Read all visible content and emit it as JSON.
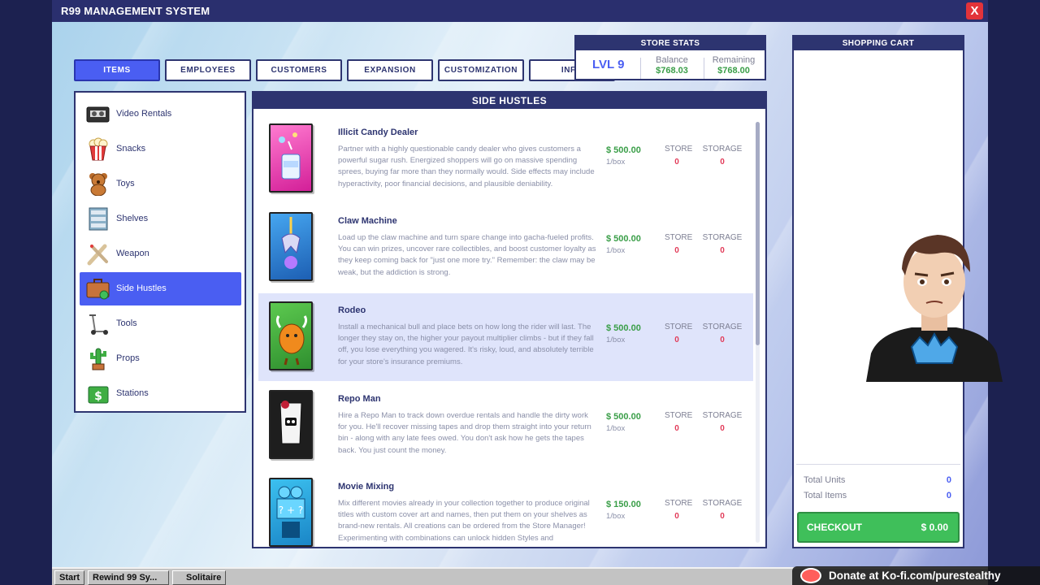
{
  "window": {
    "title": "R99 MANAGEMENT SYSTEM",
    "close_label": "X"
  },
  "tabs": [
    {
      "label": "ITEMS",
      "active": true
    },
    {
      "label": "EMPLOYEES"
    },
    {
      "label": "CUSTOMERS"
    },
    {
      "label": "EXPANSION"
    },
    {
      "label": "CUSTOMIZATION"
    },
    {
      "label": "INFO"
    }
  ],
  "stats": {
    "title": "STORE STATS",
    "level": "LVL 9",
    "balance_label": "Balance",
    "balance": "$768.03",
    "remaining_label": "Remaining",
    "remaining": "$768.00"
  },
  "categories": [
    {
      "label": "Video Rentals",
      "icon": "vhs-tape-icon"
    },
    {
      "label": "Snacks",
      "icon": "popcorn-icon"
    },
    {
      "label": "Toys",
      "icon": "teddy-bear-icon"
    },
    {
      "label": "Shelves",
      "icon": "shelf-icon"
    },
    {
      "label": "Weapon",
      "icon": "bat-icon"
    },
    {
      "label": "Side Hustles",
      "icon": "briefcase-icon",
      "active": true
    },
    {
      "label": "Tools",
      "icon": "scooter-icon"
    },
    {
      "label": "Props",
      "icon": "cactus-icon"
    },
    {
      "label": "Stations",
      "icon": "cash-icon"
    }
  ],
  "panel": {
    "title": "SIDE HUSTLES",
    "store_label": "STORE",
    "storage_label": "STORAGE",
    "items": [
      {
        "name": "Illicit Candy Dealer",
        "desc": "Partner with a highly questionable candy dealer who gives customers a powerful sugar rush. Energized shoppers will go on massive spending sprees, buying far more than they normally would. Side effects may include hyperactivity, poor financial decisions, and plausible deniability.",
        "price": "$ 500.00",
        "unit": "1/box",
        "store": "0",
        "storage": "0",
        "card_color": "#ea4fb0"
      },
      {
        "name": "Claw Machine",
        "desc": "Load up the claw machine and turn spare change into gacha-fueled profits. You can win prizes, uncover rare collectibles, and boost customer loyalty as they keep coming back for \"just one more try.\" Remember: the claw may be weak, but the addiction is strong.",
        "price": "$ 500.00",
        "unit": "1/box",
        "store": "0",
        "storage": "0",
        "card_color": "#2c83d6"
      },
      {
        "name": "Rodeo",
        "desc": "Install a mechanical bull and place bets on how long the rider will last. The longer they stay on, the higher your payout multiplier climbs - but if they fall off, you lose everything you wagered. It's risky, loud, and absolutely terrible for your store's insurance premiums.",
        "price": "$ 500.00",
        "unit": "1/box",
        "store": "0",
        "storage": "0",
        "card_color": "#3fae43",
        "selected": true
      },
      {
        "name": "Repo Man",
        "desc": "Hire a Repo Man to track down overdue rentals and handle the dirty work for you. He'll recover missing tapes and drop them straight into your return bin - along with any late fees owed. You don't ask how he gets the tapes back. You just count the money.",
        "price": "$ 500.00",
        "unit": "1/box",
        "store": "0",
        "storage": "0",
        "card_color": "#222222"
      },
      {
        "name": "Movie Mixing",
        "desc": "Mix different movies already in your collection together to produce original titles with custom cover art and names, then put them on your shelves as brand-new rentals. All creations can be ordered from the Store Manager! Experimenting with combinations can unlock hidden Styles and",
        "price": "$ 150.00",
        "unit": "1/box",
        "store": "0",
        "storage": "0",
        "card_color": "#2aa7e0"
      }
    ]
  },
  "cart": {
    "title": "SHOPPING CART",
    "total_units_label": "Total Units",
    "total_units": "0",
    "total_items_label": "Total Items",
    "total_items": "0",
    "checkout_label": "CHECKOUT",
    "checkout_amount": "$ 0.00"
  },
  "taskbar": {
    "start_label": "Start",
    "window_label": "Rewind 99 Sy...",
    "solitaire_label": "Solitaire"
  },
  "overlay": {
    "donate_text": "Donate at Ko-fi.com/purestealthy"
  }
}
